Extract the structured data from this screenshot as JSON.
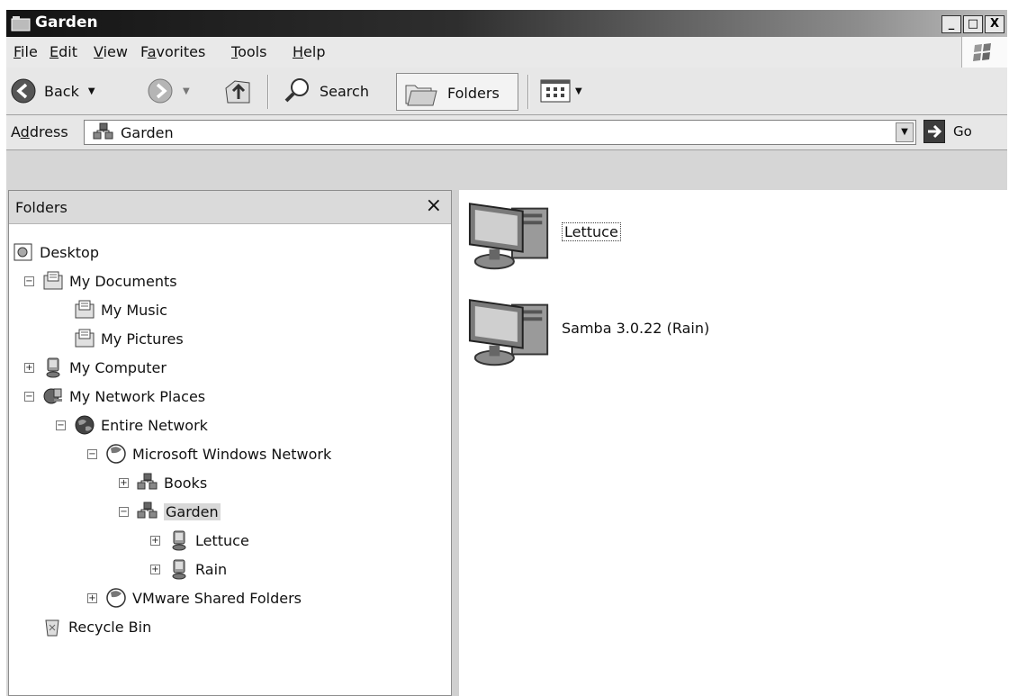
{
  "window": {
    "title": "Garden"
  },
  "menu": [
    {
      "key": "F",
      "rest": "ile"
    },
    {
      "key": "E",
      "rest": "dit"
    },
    {
      "key": "V",
      "rest": "iew"
    },
    {
      "pre": "F",
      "key": "a",
      "rest": "vorites"
    },
    {
      "key": "T",
      "rest": "ools"
    },
    {
      "key": "H",
      "rest": "elp"
    }
  ],
  "toolbar": {
    "back_label": "Back",
    "search_label": "Search",
    "folders_label": "Folders"
  },
  "address": {
    "label_pre": "A",
    "label_key": "d",
    "label_rest": "dress",
    "value": "Garden",
    "go_label": "Go"
  },
  "folders_pane": {
    "title": "Folders",
    "close": "×",
    "tree": [
      {
        "label": "Desktop",
        "icon": "desktop-icon",
        "expander": ""
      },
      {
        "label": "My Documents",
        "icon": "my-documents-icon",
        "expander": "−"
      },
      {
        "label": "My Music",
        "icon": "my-music-icon",
        "expander": ""
      },
      {
        "label": "My Pictures",
        "icon": "my-pictures-icon",
        "expander": ""
      },
      {
        "label": "My Computer",
        "icon": "my-computer-icon",
        "expander": "+"
      },
      {
        "label": "My Network Places",
        "icon": "network-places-icon",
        "expander": "−"
      },
      {
        "label": "Entire Network",
        "icon": "entire-network-icon",
        "expander": "−"
      },
      {
        "label": "Microsoft Windows Network",
        "icon": "windows-network-icon",
        "expander": "−"
      },
      {
        "label": "Books",
        "icon": "workgroup-icon",
        "expander": "+"
      },
      {
        "label": "Garden",
        "icon": "workgroup-icon",
        "expander": "−",
        "selected": true
      },
      {
        "label": "Lettuce",
        "icon": "computer-icon",
        "expander": "+"
      },
      {
        "label": "Rain",
        "icon": "computer-icon",
        "expander": "+"
      },
      {
        "label": "VMware Shared Folders",
        "icon": "windows-network-icon",
        "expander": "+"
      },
      {
        "label": "Recycle Bin",
        "icon": "recycle-bin-icon",
        "expander": ""
      }
    ]
  },
  "content": {
    "items": [
      {
        "label": "Lettuce",
        "icon": "computer-icon",
        "focused": true
      },
      {
        "label": "Samba 3.0.22 (Rain)",
        "icon": "computer-icon",
        "focused": false
      }
    ]
  }
}
